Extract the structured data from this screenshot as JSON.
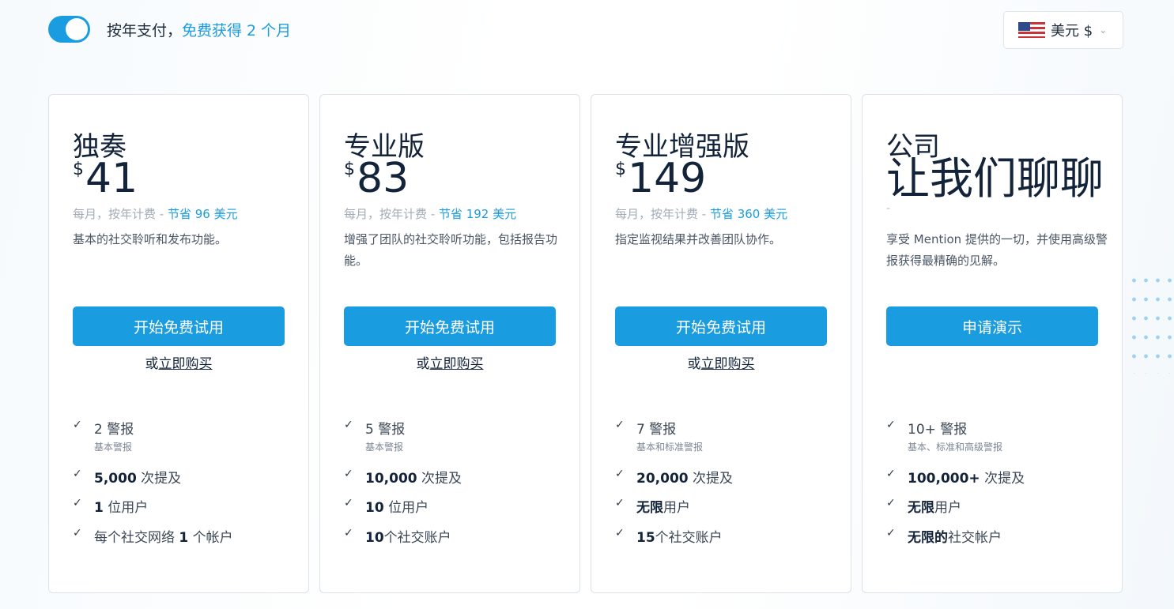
{
  "billing": {
    "toggle_on": true,
    "label_prefix": "按年支付，",
    "label_highlight": "免费获得 2 个月"
  },
  "currency": {
    "label": "美元 $",
    "flag_icon": "us-flag-icon"
  },
  "colors": {
    "accent": "#1a9ce0",
    "text_dark": "#13233a",
    "border": "#dce2e8"
  },
  "plans": [
    {
      "name": "独奏",
      "currency_symbol": "$",
      "price": "41",
      "billing_prefix": "每月，按年计费 - ",
      "billing_save": "节省 96 美元",
      "description": "基本的社交聆听和发布功能。",
      "cta": "开始免费试用",
      "buy_prefix": "或",
      "buy_link": "立即购买",
      "features": {
        "f1_main": "2 警报",
        "f1_sub": "基本警报",
        "f2_bold": "5,000",
        "f2_rest": " 次提及",
        "f3_bold": "1",
        "f3_rest": " 位用户",
        "f4_pre": "每个社交网络 ",
        "f4_bold": "1",
        "f4_rest": " 个帐户"
      }
    },
    {
      "name": "专业版",
      "currency_symbol": "$",
      "price": "83",
      "billing_prefix": "每月，按年计费 - ",
      "billing_save": "节省 192 美元",
      "description": "增强了团队的社交聆听功能，包括报告功能。",
      "cta": "开始免费试用",
      "buy_prefix": "或",
      "buy_link": "立即购买",
      "features": {
        "f1_main": "5 警报",
        "f1_sub": "基本警报",
        "f2_bold": "10,000",
        "f2_rest": " 次提及",
        "f3_bold": "10",
        "f3_rest": " 位用户",
        "f4_pre": "",
        "f4_bold": "10",
        "f4_rest": "个社交账户"
      }
    },
    {
      "name": "专业增强版",
      "currency_symbol": "$",
      "price": "149",
      "billing_prefix": "每月，按年计费 - ",
      "billing_save": "节省 360 美元",
      "description": "指定监视结果并改善团队协作。",
      "cta": "开始免费试用",
      "buy_prefix": "或",
      "buy_link": "立即购买",
      "features": {
        "f1_main": "7 警报",
        "f1_sub": "基本和标准警报",
        "f2_bold": "20,000",
        "f2_rest": " 次提及",
        "f3_bold": "无限",
        "f3_rest": "用户",
        "f4_pre": "",
        "f4_bold": "15",
        "f4_rest": "个社交账户"
      }
    },
    {
      "name": "公司",
      "price_text": "让我们聊聊",
      "dash": "-",
      "description": "享受 Mention 提供的一切，并使用高级警报获得最精确的见解。",
      "cta": "申请演示",
      "features": {
        "f1_main": "10+ 警报",
        "f1_sub": "基本、标准和高级警报",
        "f2_bold": "100,000+",
        "f2_rest": " 次提及",
        "f3_bold": "无限",
        "f3_rest": "用户",
        "f4_pre": "",
        "f4_bold": "无限的",
        "f4_rest": "社交帐户"
      }
    }
  ]
}
